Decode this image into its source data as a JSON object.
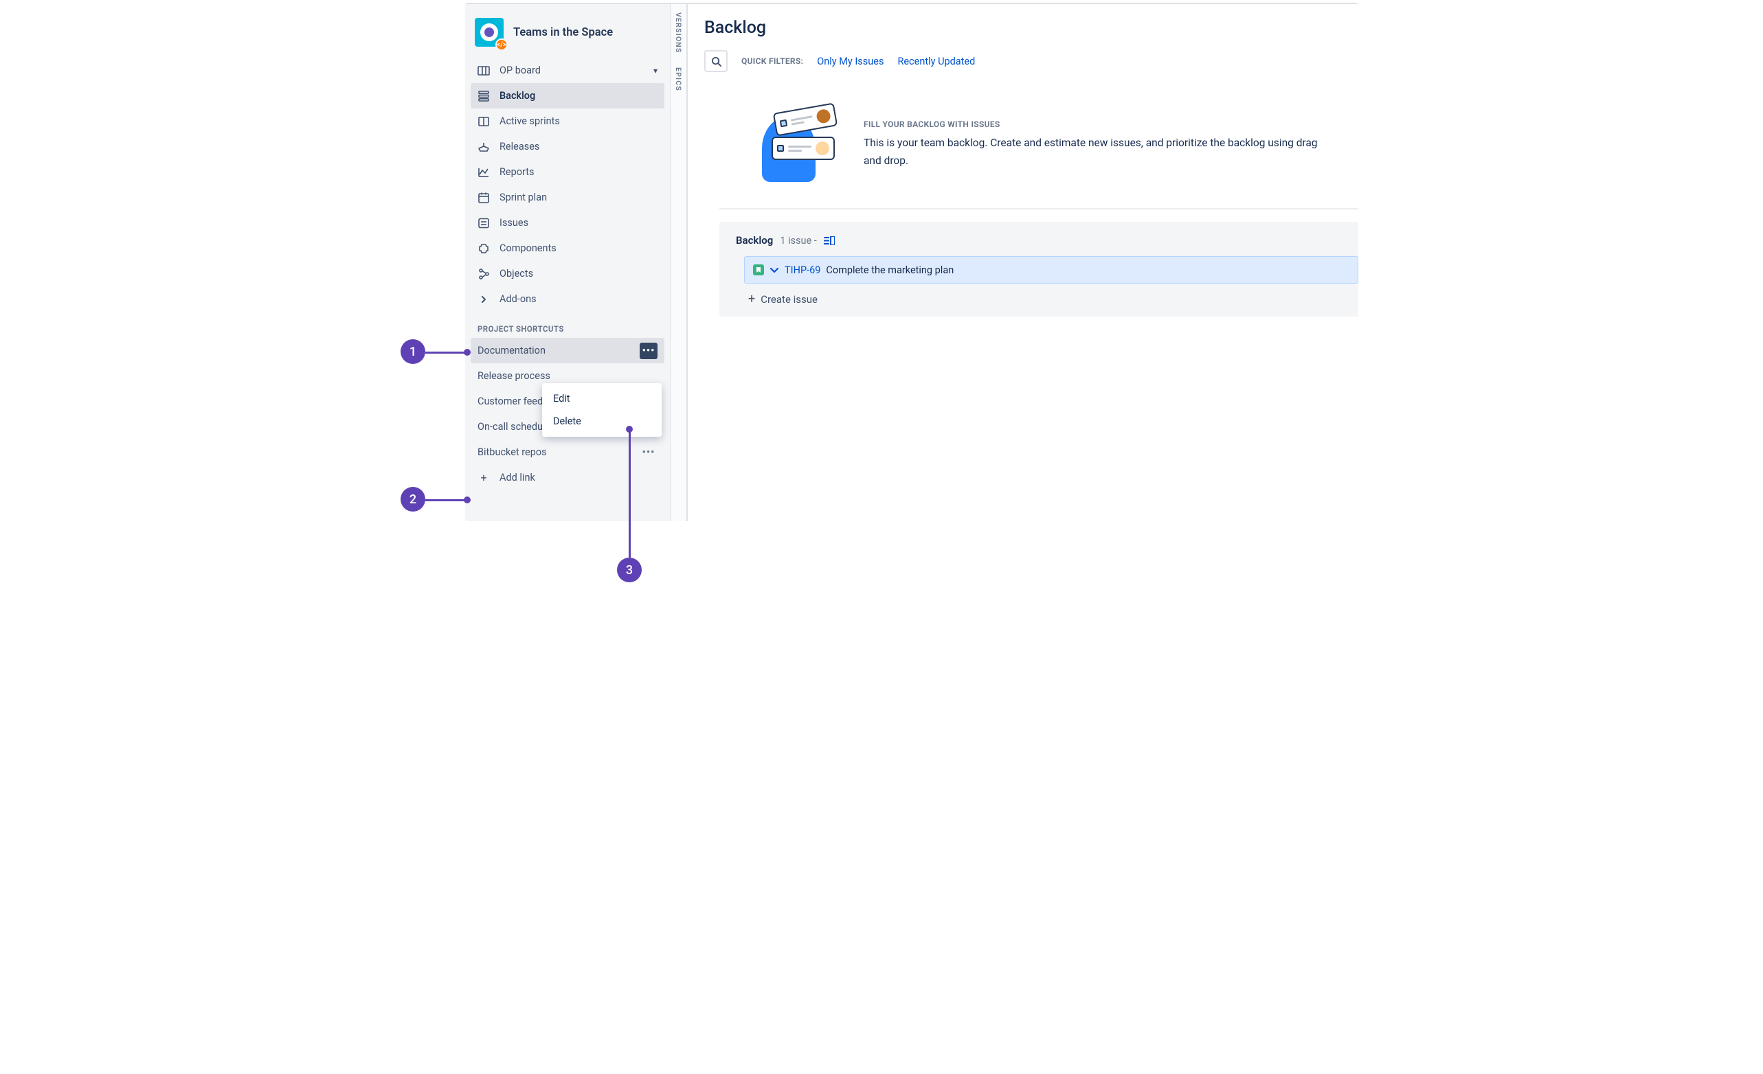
{
  "project": {
    "name": "Teams in the Space"
  },
  "sidebar": {
    "items": [
      {
        "label": "OP board",
        "icon": "board",
        "expandable": true
      },
      {
        "label": "Backlog",
        "icon": "backlog",
        "active": true
      },
      {
        "label": "Active sprints",
        "icon": "sprints"
      },
      {
        "label": "Releases",
        "icon": "releases"
      },
      {
        "label": "Reports",
        "icon": "reports"
      },
      {
        "label": "Sprint plan",
        "icon": "calendar"
      },
      {
        "label": "Issues",
        "icon": "issues"
      },
      {
        "label": "Components",
        "icon": "components"
      },
      {
        "label": "Objects",
        "icon": "objects"
      },
      {
        "label": "Add-ons",
        "icon": "addons",
        "chevron": "right"
      }
    ],
    "shortcuts_label": "PROJECT SHORTCUTS",
    "shortcuts": [
      {
        "label": "Documentation",
        "selected": true
      },
      {
        "label": "Release process"
      },
      {
        "label": "Customer feedback"
      },
      {
        "label": "On-call schedule",
        "show_more": true
      },
      {
        "label": "Bitbucket repos",
        "show_more": true
      }
    ],
    "add_link_label": "Add link"
  },
  "shortcut_menu": {
    "edit": "Edit",
    "delete": "Delete"
  },
  "rails": {
    "versions": "VERSIONS",
    "epics": "EPICS"
  },
  "page": {
    "title": "Backlog",
    "quick_filters_label": "QUICK FILTERS:",
    "filters": [
      {
        "label": "Only My Issues"
      },
      {
        "label": "Recently Updated"
      }
    ]
  },
  "intro": {
    "heading": "FILL YOUR BACKLOG WITH ISSUES",
    "body": "This is your team backlog. Create and estimate new issues, and prioritize the backlog using drag and drop."
  },
  "backlog": {
    "title": "Backlog",
    "count_text": "1 issue -",
    "issues": [
      {
        "key": "TIHP-69",
        "summary": "Complete the marketing plan"
      }
    ],
    "create_label": "Create issue"
  },
  "annotations": {
    "a1": "1",
    "a2": "2",
    "a3": "3"
  },
  "colors": {
    "purple": "#5E41B4",
    "link": "#0052CC",
    "bg_sidebar": "#F4F5F7"
  }
}
